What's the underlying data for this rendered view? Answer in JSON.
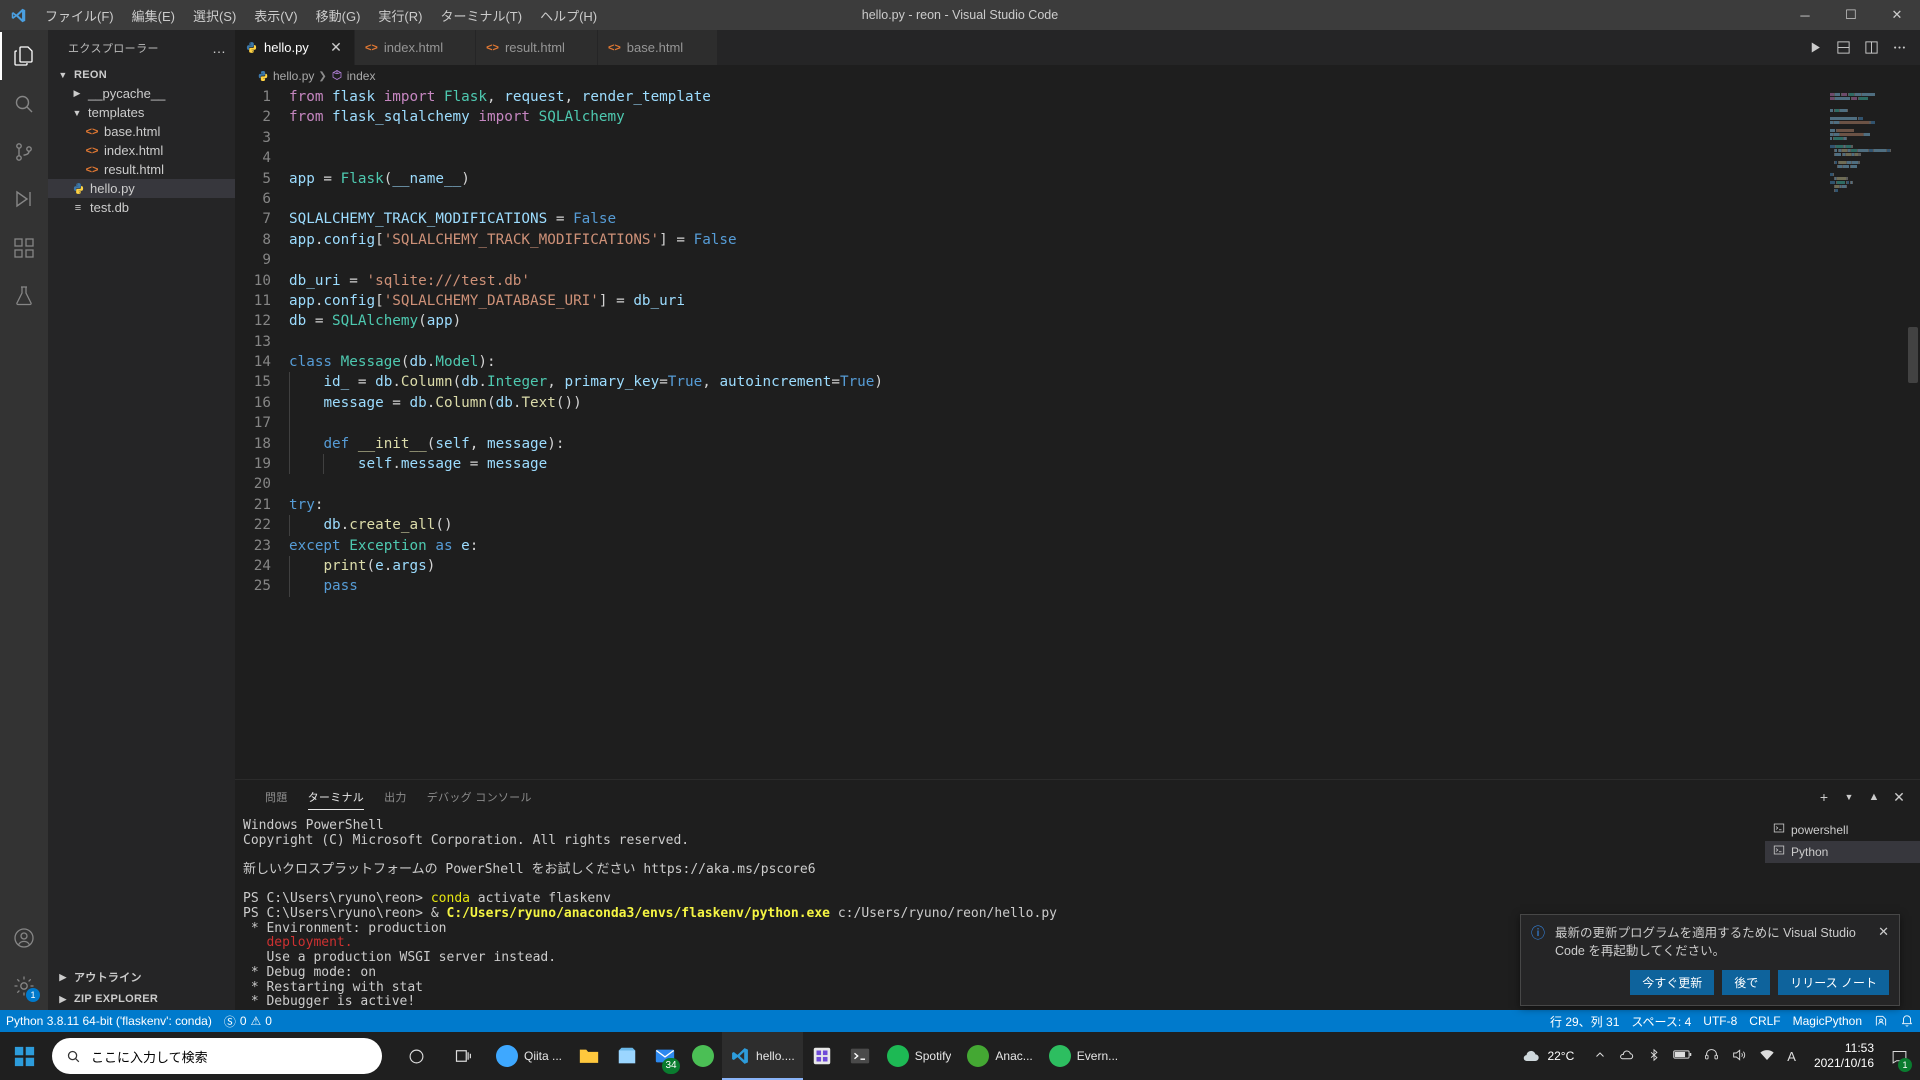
{
  "window": {
    "title": "hello.py - reon - Visual Studio Code",
    "menu": [
      "ファイル(F)",
      "編集(E)",
      "選択(S)",
      "表示(V)",
      "移動(G)",
      "実行(R)",
      "ターミナル(T)",
      "ヘルプ(H)"
    ],
    "controls": {
      "minimize": "─",
      "maximize": "☐",
      "close": "✕"
    }
  },
  "activitybar": {
    "items": [
      {
        "name": "explorer-icon",
        "glyph": "files"
      },
      {
        "name": "search-icon",
        "glyph": "search"
      },
      {
        "name": "source-control-icon",
        "glyph": "git"
      },
      {
        "name": "run-debug-icon",
        "glyph": "debug"
      },
      {
        "name": "extensions-icon",
        "glyph": "extensions"
      },
      {
        "name": "testing-icon",
        "glyph": "beaker"
      }
    ],
    "bottom": [
      {
        "name": "accounts-icon",
        "glyph": "account"
      },
      {
        "name": "settings-icon",
        "glyph": "gear",
        "badge": "1"
      }
    ]
  },
  "sidebar": {
    "title": "エクスプローラー",
    "more_label": "…",
    "root": "REON",
    "tree": [
      {
        "label": "__pycache__",
        "type": "folder",
        "expanded": false,
        "indent": 1
      },
      {
        "label": "templates",
        "type": "folder",
        "expanded": true,
        "indent": 1
      },
      {
        "label": "base.html",
        "type": "html",
        "indent": 2
      },
      {
        "label": "index.html",
        "type": "html",
        "indent": 2
      },
      {
        "label": "result.html",
        "type": "html",
        "indent": 2
      },
      {
        "label": "hello.py",
        "type": "python",
        "indent": 1,
        "selected": true
      },
      {
        "label": "test.db",
        "type": "db",
        "indent": 1
      }
    ],
    "sections": [
      {
        "label": "アウトライン",
        "expanded": false
      },
      {
        "label": "ZIP EXPLORER",
        "expanded": false
      }
    ]
  },
  "editor": {
    "tabs": [
      {
        "label": "hello.py",
        "icon": "python-icon",
        "active": true
      },
      {
        "label": "index.html",
        "icon": "html-icon",
        "active": false
      },
      {
        "label": "result.html",
        "icon": "html-icon",
        "active": false
      },
      {
        "label": "base.html",
        "icon": "html-icon",
        "active": false
      }
    ],
    "tab_actions": [
      "run-python-file-button",
      "split-editor-down-button",
      "split-editor-right-button",
      "more-actions-button"
    ],
    "breadcrumb": [
      "hello.py",
      "index"
    ],
    "code_lines": [
      {
        "n": 1,
        "tokens": [
          [
            "k",
            "from"
          ],
          [
            "pl",
            " "
          ],
          [
            "mod",
            "flask"
          ],
          [
            "pl",
            " "
          ],
          [
            "k",
            "import"
          ],
          [
            "pl",
            " "
          ],
          [
            "cls",
            "Flask"
          ],
          [
            "pl",
            ", "
          ],
          [
            "var",
            "request"
          ],
          [
            "pl",
            ", "
          ],
          [
            "var",
            "render_template"
          ]
        ]
      },
      {
        "n": 2,
        "tokens": [
          [
            "k",
            "from"
          ],
          [
            "pl",
            " "
          ],
          [
            "mod",
            "flask_sqlalchemy"
          ],
          [
            "pl",
            " "
          ],
          [
            "k",
            "import"
          ],
          [
            "pl",
            " "
          ],
          [
            "cls",
            "SQLAlchemy"
          ]
        ]
      },
      {
        "n": 3,
        "tokens": []
      },
      {
        "n": 4,
        "tokens": []
      },
      {
        "n": 5,
        "tokens": [
          [
            "var",
            "app"
          ],
          [
            "pl",
            " = "
          ],
          [
            "cls",
            "Flask"
          ],
          [
            "pl",
            "("
          ],
          [
            "var",
            "__name__"
          ],
          [
            "pl",
            ")"
          ]
        ]
      },
      {
        "n": 6,
        "tokens": []
      },
      {
        "n": 7,
        "tokens": [
          [
            "var",
            "SQLALCHEMY_TRACK_MODIFICATIONS"
          ],
          [
            "pl",
            " = "
          ],
          [
            "blu",
            "False"
          ]
        ]
      },
      {
        "n": 8,
        "tokens": [
          [
            "var",
            "app"
          ],
          [
            "pl",
            "."
          ],
          [
            "var",
            "config"
          ],
          [
            "pl",
            "["
          ],
          [
            "str",
            "'SQLALCHEMY_TRACK_MODIFICATIONS'"
          ],
          [
            "pl",
            "] = "
          ],
          [
            "blu",
            "False"
          ]
        ]
      },
      {
        "n": 9,
        "tokens": []
      },
      {
        "n": 10,
        "tokens": [
          [
            "var",
            "db_uri"
          ],
          [
            "pl",
            " = "
          ],
          [
            "str",
            "'sqlite:///test.db'"
          ]
        ]
      },
      {
        "n": 11,
        "tokens": [
          [
            "var",
            "app"
          ],
          [
            "pl",
            "."
          ],
          [
            "var",
            "config"
          ],
          [
            "pl",
            "["
          ],
          [
            "str",
            "'SQLALCHEMY_DATABASE_URI'"
          ],
          [
            "pl",
            "] = "
          ],
          [
            "var",
            "db_uri"
          ]
        ]
      },
      {
        "n": 12,
        "tokens": [
          [
            "var",
            "db"
          ],
          [
            "pl",
            " = "
          ],
          [
            "cls",
            "SQLAlchemy"
          ],
          [
            "pl",
            "("
          ],
          [
            "var",
            "app"
          ],
          [
            "pl",
            ")"
          ]
        ]
      },
      {
        "n": 13,
        "tokens": []
      },
      {
        "n": 14,
        "tokens": [
          [
            "kw",
            "class"
          ],
          [
            "pl",
            " "
          ],
          [
            "cls",
            "Message"
          ],
          [
            "pl",
            "("
          ],
          [
            "var",
            "db"
          ],
          [
            "pl",
            "."
          ],
          [
            "cls",
            "Model"
          ],
          [
            "pl",
            "):"
          ]
        ]
      },
      {
        "n": 15,
        "tokens": [
          [
            "pl",
            "    "
          ],
          [
            "var",
            "id_"
          ],
          [
            "pl",
            " = "
          ],
          [
            "var",
            "db"
          ],
          [
            "pl",
            "."
          ],
          [
            "fn",
            "Column"
          ],
          [
            "pl",
            "("
          ],
          [
            "var",
            "db"
          ],
          [
            "pl",
            "."
          ],
          [
            "cls",
            "Integer"
          ],
          [
            "pl",
            ", "
          ],
          [
            "var",
            "primary_key"
          ],
          [
            "pl",
            "="
          ],
          [
            "blu",
            "True"
          ],
          [
            "pl",
            ", "
          ],
          [
            "var",
            "autoincrement"
          ],
          [
            "pl",
            "="
          ],
          [
            "blu",
            "True"
          ],
          [
            "pl",
            ")"
          ]
        ]
      },
      {
        "n": 16,
        "tokens": [
          [
            "pl",
            "    "
          ],
          [
            "var",
            "message"
          ],
          [
            "pl",
            " = "
          ],
          [
            "var",
            "db"
          ],
          [
            "pl",
            "."
          ],
          [
            "fn",
            "Column"
          ],
          [
            "pl",
            "("
          ],
          [
            "var",
            "db"
          ],
          [
            "pl",
            "."
          ],
          [
            "fn",
            "Text"
          ],
          [
            "pl",
            "())"
          ]
        ]
      },
      {
        "n": 17,
        "tokens": []
      },
      {
        "n": 18,
        "tokens": [
          [
            "pl",
            "    "
          ],
          [
            "kw",
            "def"
          ],
          [
            "pl",
            " "
          ],
          [
            "fn",
            "__init__"
          ],
          [
            "pl",
            "("
          ],
          [
            "var",
            "self"
          ],
          [
            "pl",
            ", "
          ],
          [
            "var",
            "message"
          ],
          [
            "pl",
            "):"
          ]
        ]
      },
      {
        "n": 19,
        "tokens": [
          [
            "pl",
            "        "
          ],
          [
            "var",
            "self"
          ],
          [
            "pl",
            "."
          ],
          [
            "var",
            "message"
          ],
          [
            "pl",
            " = "
          ],
          [
            "var",
            "message"
          ]
        ]
      },
      {
        "n": 20,
        "tokens": []
      },
      {
        "n": 21,
        "tokens": [
          [
            "kw",
            "try"
          ],
          [
            "pl",
            ":"
          ]
        ]
      },
      {
        "n": 22,
        "tokens": [
          [
            "pl",
            "    "
          ],
          [
            "var",
            "db"
          ],
          [
            "pl",
            "."
          ],
          [
            "fn",
            "create_all"
          ],
          [
            "pl",
            "()"
          ]
        ]
      },
      {
        "n": 23,
        "tokens": [
          [
            "kw",
            "except"
          ],
          [
            "pl",
            " "
          ],
          [
            "cls",
            "Exception"
          ],
          [
            "pl",
            " "
          ],
          [
            "kw",
            "as"
          ],
          [
            "pl",
            " "
          ],
          [
            "var",
            "e"
          ],
          [
            "pl",
            ":"
          ]
        ]
      },
      {
        "n": 24,
        "tokens": [
          [
            "pl",
            "    "
          ],
          [
            "fn",
            "print"
          ],
          [
            "pl",
            "("
          ],
          [
            "var",
            "e"
          ],
          [
            "pl",
            "."
          ],
          [
            "var",
            "args"
          ],
          [
            "pl",
            ")"
          ]
        ]
      },
      {
        "n": 25,
        "tokens": [
          [
            "pl",
            "    "
          ],
          [
            "kw",
            "pass"
          ]
        ]
      }
    ]
  },
  "panel": {
    "tabs": [
      {
        "label": "問題",
        "active": false
      },
      {
        "label": "ターミナル",
        "active": true
      },
      {
        "label": "出力",
        "active": false
      },
      {
        "label": "デバッグ コンソール",
        "active": false
      }
    ],
    "actions": [
      "new-terminal-button",
      "terminal-dropdown-button",
      "maximize-panel-button",
      "close-panel-button"
    ],
    "terminal_lines": [
      [
        [
          "t-white",
          "Windows PowerShell"
        ]
      ],
      [
        [
          "t-white",
          "Copyright (C) Microsoft Corporation. All rights reserved."
        ]
      ],
      [],
      [
        [
          "t-white",
          "新しいクロスプラットフォームの PowerShell をお試しください https://aka.ms/pscore6"
        ]
      ],
      [],
      [
        [
          "t-white",
          "PS C:\\Users\\ryuno\\reon> "
        ],
        [
          "t-yellow",
          "conda"
        ],
        [
          "t-white",
          " activate flaskenv"
        ]
      ],
      [
        [
          "t-white",
          "PS C:\\Users\\ryuno\\reon> & "
        ],
        [
          "t-yellow-b",
          "C:/Users/ryuno/anaconda3/envs/flaskenv/python.exe"
        ],
        [
          "t-white",
          " c:/Users/ryuno/reon/hello.py"
        ]
      ],
      [
        [
          "t-white",
          " * Environment: production"
        ]
      ],
      [
        [
          "t-red",
          "   deployment."
        ]
      ],
      [
        [
          "t-white",
          "   Use a production WSGI server instead."
        ]
      ],
      [
        [
          "t-white",
          " * Debug mode: on"
        ]
      ],
      [
        [
          "t-white",
          " * Restarting with stat"
        ]
      ],
      [
        [
          "t-white",
          " * Debugger is active!"
        ]
      ]
    ],
    "terminal_list": [
      {
        "label": "powershell",
        "active": false
      },
      {
        "label": "Python",
        "active": true
      }
    ]
  },
  "notification": {
    "icon": "info-icon",
    "message": "最新の更新プログラムを適用するために Visual Studio Code を再起動してください。",
    "close_label": "✕",
    "buttons": [
      "今すぐ更新",
      "後で",
      "リリース ノート"
    ]
  },
  "statusbar": {
    "left": [
      {
        "name": "python-interpreter",
        "label": "Python 3.8.11 64-bit ('flaskenv': conda)"
      },
      {
        "name": "problems-counts",
        "label": "0    0",
        "errors": "0",
        "warnings": "0"
      }
    ],
    "right": [
      {
        "name": "cursor-position",
        "label": "行 29、列 31"
      },
      {
        "name": "indentation",
        "label": "スペース: 4"
      },
      {
        "name": "encoding",
        "label": "UTF-8"
      },
      {
        "name": "eol",
        "label": "CRLF"
      },
      {
        "name": "language-mode",
        "label": "MagicPython"
      },
      {
        "name": "live-share",
        "label": ""
      },
      {
        "name": "notifications-bell",
        "label": ""
      }
    ]
  },
  "taskbar": {
    "search_placeholder": "ここに入力して検索",
    "apps": [
      {
        "name": "taskbar-app-qiita",
        "label": "Qiita ...",
        "color": "#3ea8ff",
        "active": false
      },
      {
        "name": "taskbar-app-explorer",
        "label": "",
        "color": "#ffc83d",
        "active": false
      },
      {
        "name": "taskbar-app-store",
        "label": "",
        "color": "#9bd6ff",
        "active": false
      },
      {
        "name": "taskbar-app-mail",
        "label": "",
        "color": "#2d89ef",
        "badge": "34",
        "active": false
      },
      {
        "name": "taskbar-app-python",
        "label": "",
        "color": "#4bbf55",
        "active": false
      },
      {
        "name": "taskbar-app-vscode",
        "label": "hello....",
        "color": "#2d9cdb",
        "active": true
      },
      {
        "name": "taskbar-app-store2",
        "label": "",
        "color": "#6e4bd8",
        "active": false
      },
      {
        "name": "taskbar-app-terminal",
        "label": "",
        "color": "#4a4a4a",
        "active": false
      },
      {
        "name": "taskbar-app-spotify",
        "label": "Spotify",
        "color": "#1db954",
        "active": false
      },
      {
        "name": "taskbar-app-anaconda",
        "label": "Anac...",
        "color": "#44a833",
        "active": false
      },
      {
        "name": "taskbar-app-evernote",
        "label": "Evern...",
        "color": "#2dbe60",
        "active": false
      }
    ],
    "weather": {
      "icon": "cloud-icon",
      "temp": "22°C"
    },
    "clock": {
      "time": "11:53",
      "date": "2021/10/16"
    },
    "notification_count": "1"
  }
}
